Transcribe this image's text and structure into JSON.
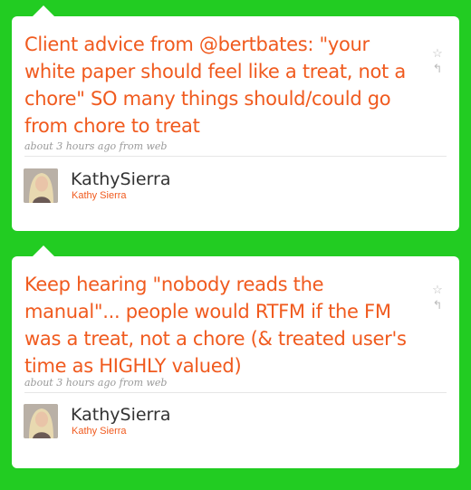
{
  "tweets": [
    {
      "text": "Client advice from @bertbates: \"your white paper should feel like a treat, not a chore\" SO many things should/could go from chore to treat",
      "meta": "about 3 hours ago from web",
      "username": "KathySierra",
      "fullname": "Kathy Sierra"
    },
    {
      "text": "Keep hearing \"nobody reads the manual\"... people would RTFM if the FM was a treat, not a chore (& treated user's time as HIGHLY valued)",
      "meta": "about 3 hours ago from web",
      "username": "KathySierra",
      "fullname": "Kathy Sierra"
    }
  ],
  "icons": {
    "star": "star-icon",
    "reply": "reply-icon"
  },
  "colors": {
    "background": "#22cc22",
    "tweet_text": "#f05a1e",
    "fullname": "#f05a1e"
  }
}
